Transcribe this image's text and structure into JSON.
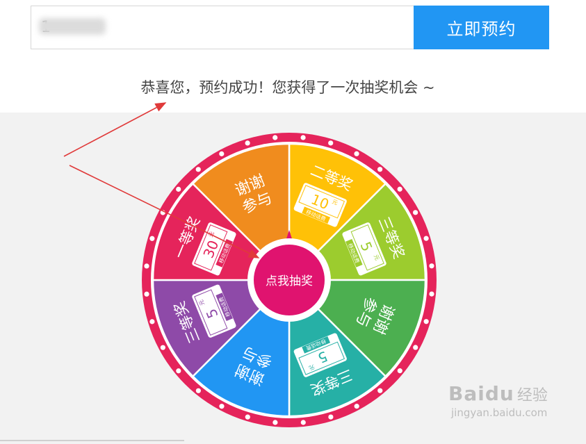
{
  "form": {
    "phone_value": "1",
    "phone_masked_tail": "96 93627",
    "reserve_button_label": "立即预约"
  },
  "message": {
    "success_text": "恭喜您，预约成功！您获得了一次抽奖机会 ~"
  },
  "wheel": {
    "center_button_label": "点我抽奖",
    "sectors": [
      {
        "prize": "二等奖",
        "amount": "10",
        "unit": "元",
        "note": "移动话费",
        "color": "#ffc107"
      },
      {
        "prize": "三等奖",
        "amount": "5",
        "unit": "元",
        "note": "移动话费",
        "color": "#9ccc2e"
      },
      {
        "prize": "谢谢参与",
        "line1": "谢谢",
        "line2": "参与",
        "color": "#4caf50"
      },
      {
        "prize": "三等奖",
        "amount": "5",
        "unit": "元",
        "note": "移动话费",
        "color": "#26b0a6"
      },
      {
        "prize": "谢谢参与",
        "line1": "谢谢",
        "line2": "参与",
        "color": "#2196f3"
      },
      {
        "prize": "三等奖",
        "amount": "5",
        "unit": "元",
        "note": "移动话费",
        "color": "#8e4aa8"
      },
      {
        "prize": "一等奖",
        "amount": "30",
        "unit": "元",
        "note": "移动话费",
        "color": "#e5245b"
      },
      {
        "prize": "谢谢参与",
        "line1": "谢谢",
        "line2": "参与",
        "color": "#f08c1e"
      }
    ],
    "rim_color": "#e5245b",
    "pointer_color": "#e0136f"
  },
  "watermark": {
    "brand": "Baidu",
    "cn": "经验",
    "url": "jingyan.baidu.com"
  }
}
